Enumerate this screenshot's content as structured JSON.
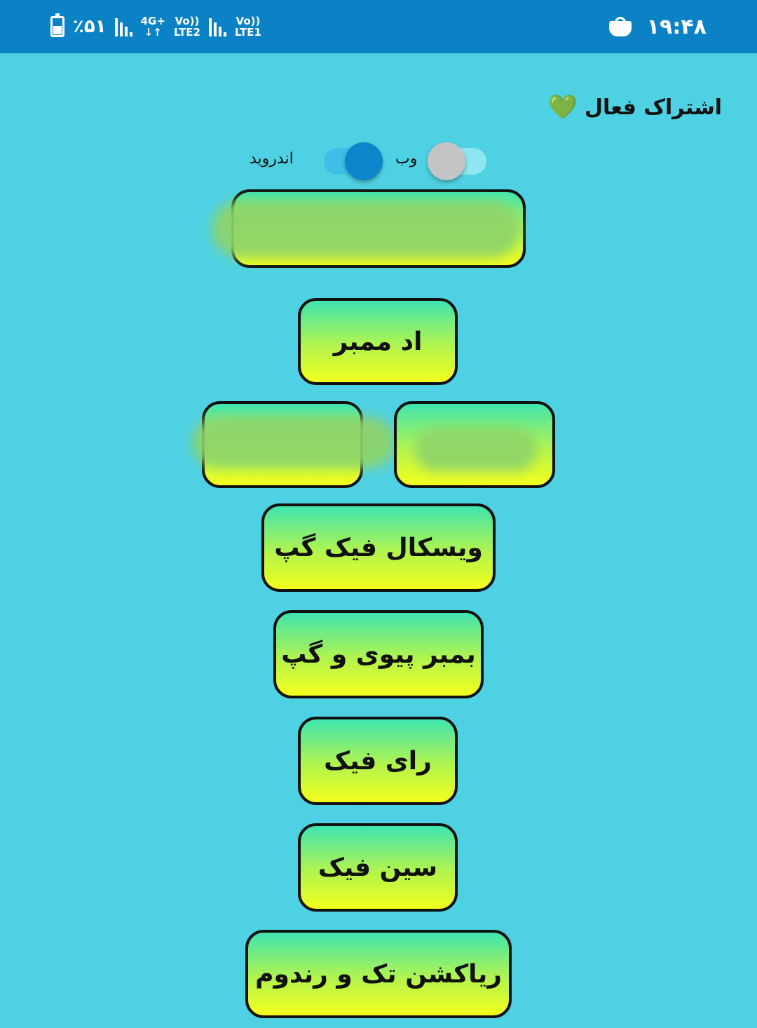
{
  "status_bar": {
    "time": "۱۹:۴۸",
    "battery_text": "٪۵۱",
    "network_1_top": "4G+",
    "network_1_bottom": "↓↑",
    "lte2_top": "Vo))",
    "lte2_bottom": "LTE2",
    "lte1_top": "Vo))",
    "lte1_bottom": "LTE1",
    "icons": [
      "battery-icon",
      "signal-icon",
      "signal-icon",
      "shopping-bag-icon"
    ]
  },
  "header": {
    "subscription_label": "اشتراک فعال",
    "heart_glyph": "💚"
  },
  "platform_toggle": {
    "web_label": "وب",
    "android_label": "اندروید",
    "web_on": false,
    "android_on": true,
    "colors": {
      "on_track": "#3ec0e6",
      "on_knob": "#0b86cb",
      "off_track": "#8ee6f0",
      "off_knob": "#c4c4c4"
    }
  },
  "buttons": {
    "add_member": "اد ممبر",
    "visual_fake_gap": "ویسکال فیک گپ",
    "bomber": "بمبر پیوی و گپ",
    "fake_vote": "رای فیک",
    "fake_seen": "سین فیک",
    "reaction": "ریاکشن تک و رندوم"
  },
  "colors": {
    "background": "#4ed1e2",
    "status_bar": "#0b82c5",
    "button_gradient_top": "#3fe4b0",
    "button_gradient_bottom": "#f4ff1c",
    "button_border": "#111111"
  }
}
